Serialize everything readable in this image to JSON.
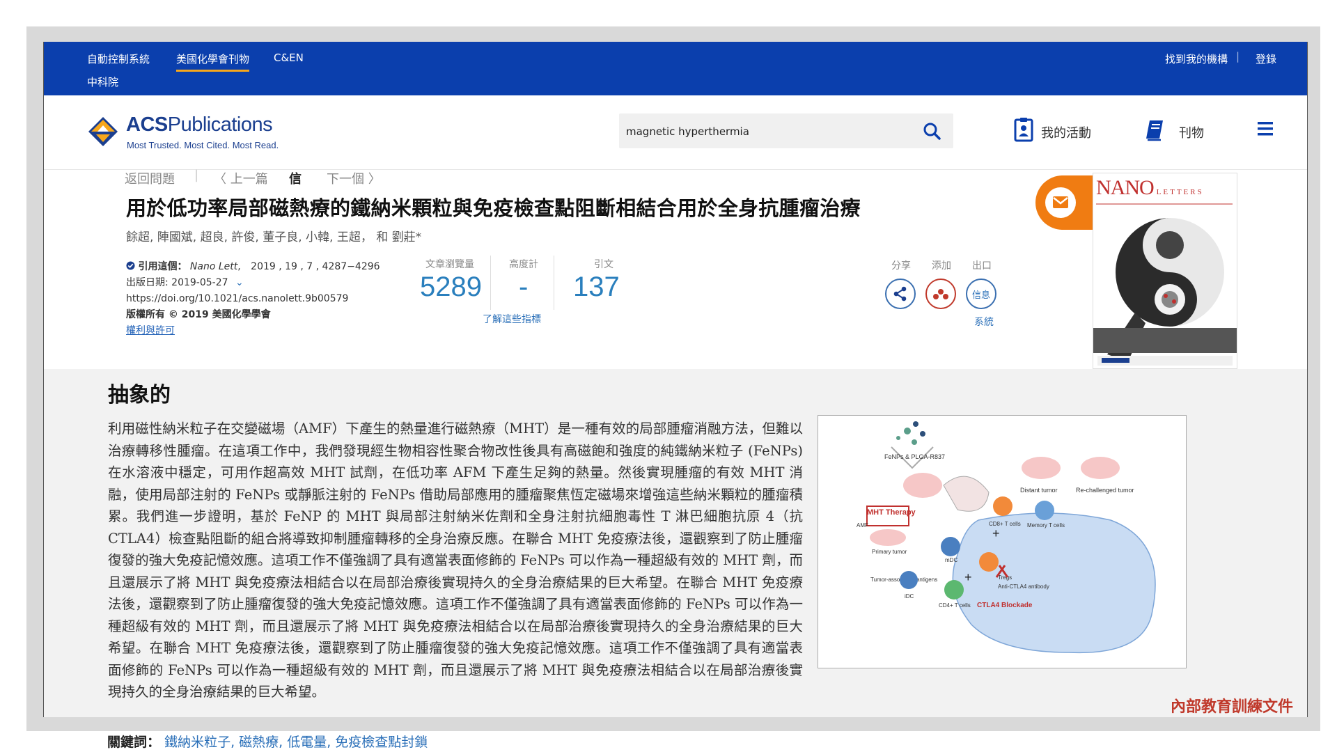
{
  "topbar": {
    "items": [
      "自動控制系統",
      "美國化學會刊物",
      "C&EN"
    ],
    "institution": "中科院",
    "right_links": [
      "找到我的機構",
      "登錄"
    ],
    "separator": "|"
  },
  "header": {
    "logo_title_bold": "ACS",
    "logo_title_rest": "Publications",
    "logo_tagline": "Most Trusted. Most Cited. Most Read.",
    "search_value": "magnetic hyperthermia",
    "my_activity": "我的活動",
    "publications": "刊物"
  },
  "breadcrumbs": {
    "back": "返回問題",
    "prev": "〈 上一篇",
    "current": "信",
    "next": "下一個 〉"
  },
  "article": {
    "title": "用於低功率局部磁熱療的鐵納米顆粒與免疫檢查點阻斷相結合用於全身抗腫瘤治療",
    "authors": "餘超, 陣國斌, 超良, 許俊, 董子良, 小韓, 王超， 和 劉莊*",
    "cite_label": "引用這個：",
    "journal": "Nano Lett",
    "cite_details": "2019 , 19 , 7 , 4287−4296",
    "pub_date": "出版日期: 2019-05-27",
    "doi": "https://doi.org/10.1021/acs.nanolett.9b00579",
    "copyright": "版權所有 © 2019 美國化學學會",
    "rights_link": "權利與許可"
  },
  "metrics": {
    "views_label": "文章瀏覽量",
    "views": "5289",
    "altmetric_label": "高度計",
    "altmetric": "-",
    "citations_label": "引文",
    "citations": "137",
    "learn_link": "了解這些指標"
  },
  "actions": {
    "share_label": "分享",
    "add_label": "添加",
    "export_label": "出口",
    "info_text": "信息",
    "system_label": "系統"
  },
  "cover": {
    "title_big": "NANO",
    "title_small": "LETTERS"
  },
  "abstract": {
    "heading": "抽象的",
    "text": "利用磁性納米粒子在交變磁場（AMF）下產生的熱量進行磁熱療（MHT）是一種有效的局部腫瘤消融方法，但難以治療轉移性腫瘤。在這項工作中，我們發現經生物相容性聚合物改性後具有高磁飽和強度的純鐵納米粒子 (FeNPs) 在水溶液中穩定，可用作超高效 MHT 試劑，在低功率 AFM 下產生足夠的熱量。然後實現腫瘤的有效 MHT 消融，使用局部注射的 FeNPs 或靜脈注射的 FeNPs 借助局部應用的腫瘤聚焦恆定磁場來增強這些納米顆粒的腫瘤積累。我們進一步證明，基於 FeNP 的 MHT 與局部注射納米佐劑和全身注射抗細胞毒性 T 淋巴細胞抗原 4（抗 CTLA4）檢查點阻斷的組合將導致抑制腫瘤轉移的全身治療反應。在聯合 MHT 免疫療法後，還觀察到了防止腫瘤復發的強大免疫記憶效應。這項工作不僅強調了具有適當表面修飾的 FeNPs 可以作為一種超級有效的 MHT 劑，而且還展示了將 MHT 與免疫療法相結合以在局部治療後實現持久的全身治療結果的巨大希望。在聯合 MHT 免疫療法後，還觀察到了防止腫瘤復發的強大免疫記憶效應。這項工作不僅強調了具有適當表面修飾的 FeNPs 可以作為一種超級有效的 MHT 劑，而且還展示了將 MHT 與免疫療法相結合以在局部治療後實現持久的全身治療結果的巨大希望。在聯合 MHT 免疫療法後，還觀察到了防止腫瘤復發的強大免疫記憶效應。這項工作不僅強調了具有適當表面修飾的 FeNPs 可以作為一種超級有效的 MHT 劑，而且還展示了將 MHT 與免疫療法相結合以在局部治療後實現持久的全身治療結果的巨大希望。"
  },
  "toc_figure": {
    "labels": {
      "fenps": "FeNPs & PLGA-R837",
      "distant": "Distant tumor",
      "rechallenged": "Re-challenged tumor",
      "mht": "MHT Therapy",
      "amf": "AMF",
      "primary": "Primary tumor",
      "cd8": "CD8+ T cells",
      "memory": "Memory T cells",
      "taa": "Tumor-associated antigens",
      "mdc": "mDC",
      "tregs": "Tregs",
      "anti_ctla4": "Anti-CTLA4 antibody",
      "idc": "iDC",
      "cd4": "CD4+ T cells",
      "blockade": "CTLA4 Blockade"
    }
  },
  "watermark": "內部教育訓練文件",
  "keywords": {
    "label": "關鍵詞：",
    "values": "鐵納米粒子, 磁熱療, 低電量, 免疫檢查點封鎖"
  },
  "colors": {
    "topbar": "#0b3fad",
    "accent": "#f7a71b",
    "brand": "#1b3f8f",
    "metric": "#2a7fbd",
    "mail_tab": "#f07c12",
    "watermark": "#c0392b"
  }
}
